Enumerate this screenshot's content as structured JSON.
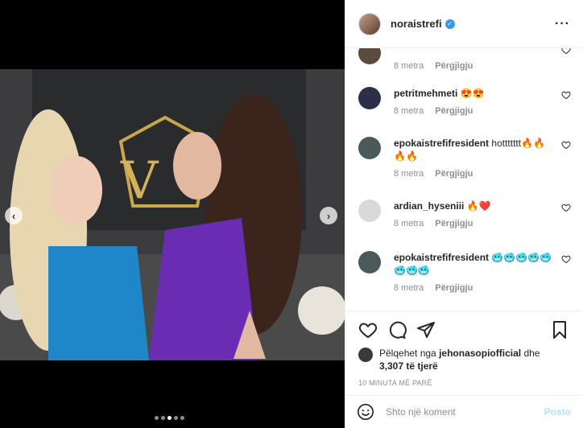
{
  "post": {
    "author": "noraistrefi",
    "verified": true
  },
  "media": {
    "slide_count": 5,
    "active_slide": 2
  },
  "comments": [
    {
      "user": "",
      "text": "",
      "age": "8 metra",
      "reply": "Përgjigju"
    },
    {
      "user": "petritmehmeti",
      "text": "😍😍",
      "age": "8 metra",
      "reply": "Përgjigju"
    },
    {
      "user": "epokaistrefifresident",
      "text": "hottttttt🔥🔥🔥🔥",
      "age": "8 metra",
      "reply": "Përgjigju"
    },
    {
      "user": "ardian_hyseniii",
      "text": "🔥❤️",
      "age": "8 metra",
      "reply": "Përgjigju"
    },
    {
      "user": "epokaistrefifresident",
      "text": "🥶🥶🥶🥶🥶🥶🥶🥶",
      "age": "8 metra",
      "reply": "Përgjigju"
    }
  ],
  "likes": {
    "prefix": "Pëlqehet nga",
    "user": "jehonasopiofficial",
    "suffix": "dhe",
    "count": "3,307 të tjerë"
  },
  "timestamp": "10 MINUTA MË PARË",
  "add_comment": {
    "placeholder": "Shto një koment",
    "post_label": "Posto"
  }
}
